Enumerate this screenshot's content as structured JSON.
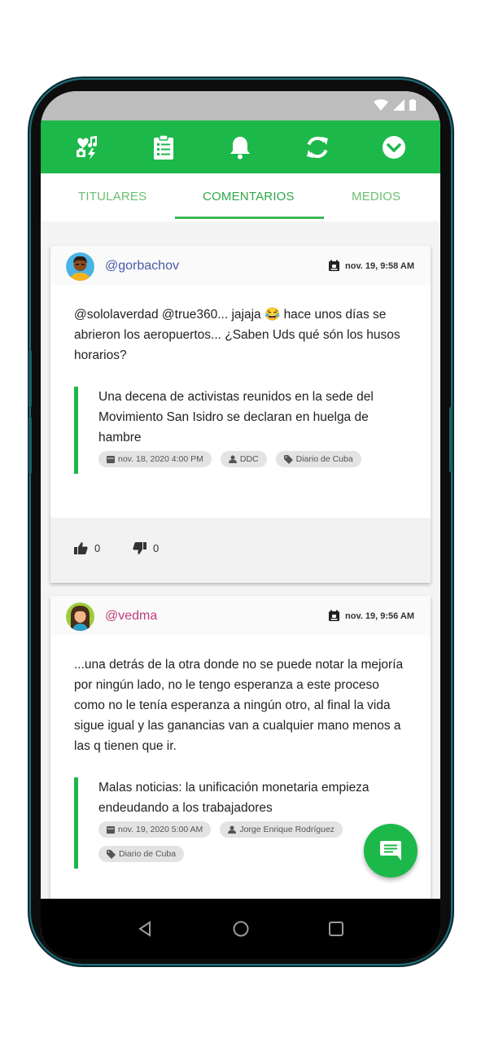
{
  "toolbar": {
    "icons": [
      "heart-music-icon",
      "clipboard-icon",
      "bell-icon",
      "refresh-icon",
      "check-circle-icon"
    ],
    "color": "#1db84a"
  },
  "tabs": [
    {
      "label": "TITULARES",
      "active": false
    },
    {
      "label": "COMENTARIOS",
      "active": true
    },
    {
      "label": "MEDIOS",
      "active": false
    }
  ],
  "posts": [
    {
      "username": "@gorbachov",
      "username_color": "#4a5aa8",
      "date": "nov. 19, 9:58 AM",
      "comment": "@sololaverdad @true360... jajaja 😂 hace unos días se abrieron los aeropuertos... ¿Saben Uds qué són los husos horarios?",
      "article": {
        "title": "Una decena de activistas reunidos en la sede del Movimiento San Isidro se declaran en huelga de hambre",
        "date": "nov. 18, 2020 4:00 PM",
        "author": "DDC",
        "source": "Diario de Cuba"
      },
      "likes": "0",
      "dislikes": "0"
    },
    {
      "username": "@vedma",
      "username_color": "#c0407a",
      "date": "nov. 19, 9:56 AM",
      "comment": "...una detrás de la otra donde no se puede notar la mejoría por ningún lado, no le tengo esperanza a este proceso como no le tenía esperanza a ningún otro, al final la vida sigue igual y las ganancias van a cualquier mano menos a las q tienen que ir.",
      "article": {
        "title": "Malas noticias: la unificación monetaria empieza endeudando a los trabajadores",
        "date": "nov. 19, 2020 5:00 AM",
        "author": "Jorge Enrique Rodríguez",
        "source": "Diario de Cuba"
      }
    }
  ],
  "fab": {
    "icon": "chat-icon"
  },
  "navbar": {
    "icons": [
      "back-icon",
      "home-icon",
      "recents-icon"
    ]
  }
}
